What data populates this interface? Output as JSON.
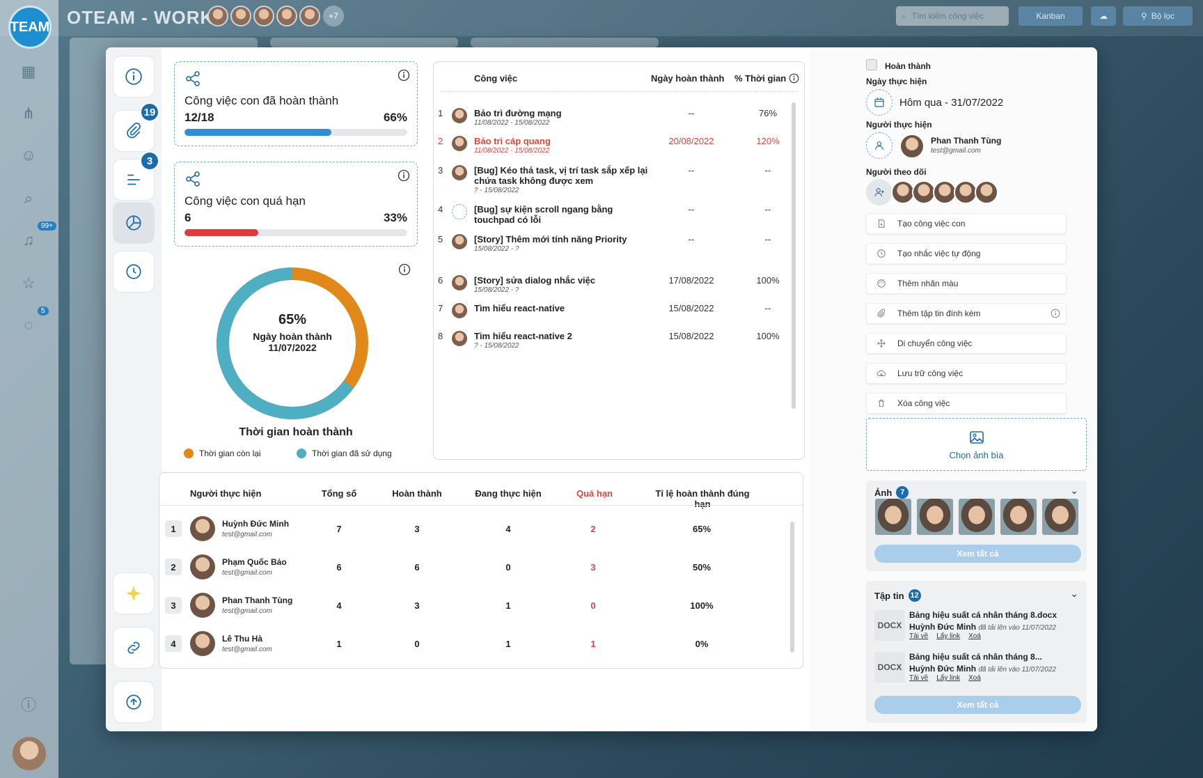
{
  "app": {
    "name": "OTEAM - WORK",
    "logo_text": "TEAM",
    "member_overflow": "+7",
    "search_placeholder": "Tìm kiếm công việc",
    "view_button": "Kanban",
    "filter_button": "Bộ lọc",
    "nav_badges": [
      "99+",
      "5"
    ]
  },
  "sidebar": {
    "attachments_badge": "19",
    "subtasks_badge": "3"
  },
  "stats": {
    "completed": {
      "title": "Công việc con đã hoàn thành",
      "count": "12/18",
      "percent": "66%",
      "value": 0.66,
      "color": "#2f8fd6"
    },
    "overdue": {
      "title": "Công việc con quá hạn",
      "count": "6",
      "percent": "33%",
      "value": 0.33,
      "color": "#e0393e"
    }
  },
  "donut": {
    "percent": "65%",
    "label": "Ngày hoàn thành",
    "date": "11/07/2022",
    "title": "Thời gian hoàn thành",
    "used_fraction": 0.65,
    "legend_remaining": "Thời gian còn lại",
    "legend_used": "Thời gian đã sử dụng",
    "color_remaining": "#e0891a",
    "color_used": "#4eaec2"
  },
  "tasks": {
    "headers": {
      "task": "Công việc",
      "done_date": "Ngày hoàn thành",
      "time_pct": "% Thời gian"
    },
    "rows": [
      {
        "idx": "1",
        "name": "Bảo trì đường mạng",
        "dates": "11/08/2022 - 15/08/2022",
        "done": "--",
        "pct": "76%",
        "late": false
      },
      {
        "idx": "2",
        "name": "Bảo trì cáp quang",
        "dates": "11/08/2022 - 15/08/2022",
        "done": "20/08/2022",
        "pct": "120%",
        "late": true
      },
      {
        "idx": "3",
        "name": "[Bug] Kéo thả task, vị trí task sắp xếp lại chứa task không được xem",
        "dates": "? - 15/08/2022",
        "done": "--",
        "pct": "--",
        "late": false
      },
      {
        "idx": "4",
        "name": "[Bug] sự kiện scroll ngang bằng touchpad có lỗi",
        "dates": "",
        "done": "--",
        "pct": "--",
        "late": false
      },
      {
        "idx": "5",
        "name": "[Story] Thêm mới tính năng Priority",
        "dates": "15/08/2022 - ?",
        "done": "--",
        "pct": "--",
        "late": false
      },
      {
        "idx": "6",
        "name": "[Story] sửa dialog nhắc việc",
        "dates": "15/08/2022 - ?",
        "done": "17/08/2022",
        "pct": "100%",
        "late": false
      },
      {
        "idx": "7",
        "name": "Tìm hiểu react-native",
        "dates": "",
        "done": "15/08/2022",
        "pct": "--",
        "late": false
      },
      {
        "idx": "8",
        "name": "Tìm hiểu react-native 2",
        "dates": "? - 15/08/2022",
        "done": "15/08/2022",
        "pct": "100%",
        "late": false
      }
    ]
  },
  "people": {
    "headers": {
      "person": "Người thực hiện",
      "total": "Tổng số",
      "done": "Hoàn thành",
      "doing": "Đang thực hiện",
      "overdue": "Quá hạn",
      "ontime": "Tỉ lệ hoàn thành đúng hạn"
    },
    "rows": [
      {
        "idx": "1",
        "name": "Huỳnh Đức Minh",
        "email": "test@gmail.com",
        "total": "7",
        "done": "3",
        "doing": "4",
        "overdue": "2",
        "ontime": "65%"
      },
      {
        "idx": "2",
        "name": "Phạm Quốc Bảo",
        "email": "test@gmail.com",
        "total": "6",
        "done": "6",
        "doing": "0",
        "overdue": "3",
        "ontime": "50%"
      },
      {
        "idx": "3",
        "name": "Phan Thanh Tùng",
        "email": "test@gmail.com",
        "total": "4",
        "done": "3",
        "doing": "1",
        "overdue": "0",
        "ontime": "100%"
      },
      {
        "idx": "4",
        "name": "Lê Thu Hà",
        "email": "test@gmail.com",
        "total": "1",
        "done": "0",
        "doing": "1",
        "overdue": "1",
        "ontime": "0%"
      }
    ]
  },
  "right": {
    "complete_label": "Hoàn thành",
    "date_label": "Ngày thực hiện",
    "date_value": "Hôm qua - 31/07/2022",
    "assignee_label": "Người thực hiện",
    "assignee_name": "Phan Thanh Tùng",
    "assignee_email": "test@gmail.com",
    "followers_label": "Người theo dõi",
    "actions": [
      "Tạo công việc con",
      "Tạo nhắc việc tự động",
      "Thêm nhãn màu",
      "Thêm tập tin đính kèm",
      "Di chuyển công việc",
      "Lưu trữ công việc",
      "Xóa công việc"
    ],
    "cover_label": "Chọn ảnh bìa",
    "photos_label": "Ảnh",
    "photos_count": "7",
    "see_all": "Xem tất cả",
    "files_label": "Tập tin",
    "files_count": "12",
    "files": [
      {
        "type": "DOCX",
        "name": "Bảng hiệu suất cá nhân tháng 8.docx",
        "owner": "Huỳnh Đức Minh",
        "uploaded": "đã tải lên vào 11/07/2022",
        "download": "Tải về",
        "link": "Lấy link",
        "delete": "Xoá"
      },
      {
        "type": "DOCX",
        "name": "Bảng hiệu suất cá nhân tháng 8...",
        "owner": "Huỳnh Đức Minh",
        "uploaded": "đã tải lên vào 11/07/2022",
        "download": "Tải về",
        "link": "Lấy link",
        "delete": "Xoá"
      }
    ]
  }
}
